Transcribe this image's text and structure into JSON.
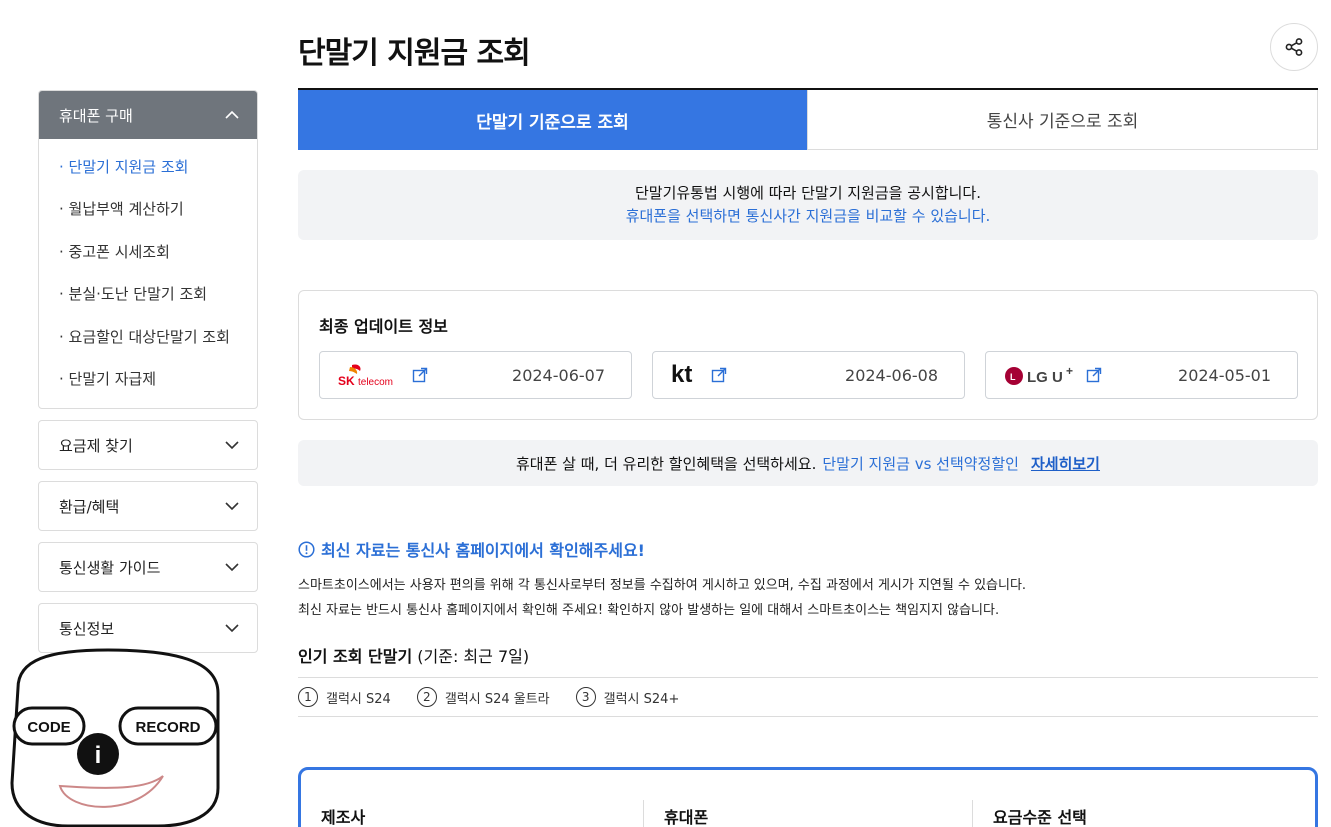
{
  "page": {
    "title": "단말기 지원금 조회"
  },
  "sidebar": {
    "open_section": {
      "label": "휴대폰 구매",
      "items": [
        {
          "label": "· 단말기 지원금 조회",
          "active": true
        },
        {
          "label": "· 월납부액 계산하기",
          "active": false
        },
        {
          "label": "· 중고폰 시세조회",
          "active": false
        },
        {
          "label": "· 분실·도난 단말기 조회",
          "active": false
        },
        {
          "label": "· 요금할인 대상단말기 조회",
          "active": false
        },
        {
          "label": "· 단말기 자급제",
          "active": false
        }
      ]
    },
    "closed_sections": [
      "요금제 찾기",
      "환급/혜택",
      "통신생활 가이드",
      "통신정보"
    ]
  },
  "tabs": [
    {
      "label": "단말기 기준으로 조회",
      "active": true
    },
    {
      "label": "통신사 기준으로 조회",
      "active": false
    }
  ],
  "notice": {
    "line1": "단말기유통법 시행에 따라 단말기 지원금을 공시합니다.",
    "line2": "휴대폰을 선택하면 통신사간 지원금을 비교할 수 있습니다."
  },
  "update": {
    "title": "최종 업데이트 정보",
    "carriers": [
      {
        "name": "SK telecom",
        "date": "2024-06-07"
      },
      {
        "name": "kt",
        "date": "2024-06-08"
      },
      {
        "name": "LG U+",
        "date": "2024-05-01"
      }
    ]
  },
  "promo": {
    "text": "휴대폰 살 때, 더 유리한 할인혜택을 선택하세요.",
    "highlight": "단말기 지원금 vs 선택약정할인",
    "link": "자세히보기"
  },
  "alert": {
    "title": "최신 자료는 통신사 홈페이지에서 확인해주세요!",
    "line1": "스마트초이스에서는 사용자 편의를 위해 각 통신사로부터 정보를 수집하여 게시하고 있으며, 수집 과정에서 게시가 지연될 수 있습니다.",
    "line2": "최신 자료는 반드시 통신사 홈페이지에서 확인해 주세요! 확인하지 않아 발생하는 일에 대해서 스마트초이스는 책임지지 않습니다."
  },
  "popular": {
    "title_bold": "인기 조회 단말기",
    "title_note": " (기준: 최근 7일)",
    "items": [
      {
        "rank": "1",
        "name": "갤럭시 S24"
      },
      {
        "rank": "2",
        "name": "갤럭시 S24 울트라"
      },
      {
        "rank": "3",
        "name": "갤럭시 S24+"
      }
    ]
  },
  "filter": {
    "maker": "제조사",
    "phone": "휴대폰",
    "plan": "요금수준 선택"
  },
  "mascot": {
    "left": "CODE",
    "right": "RECORD",
    "center": "i"
  },
  "colors": {
    "accent": "#3576e2",
    "link": "#2b6fd6",
    "sidebar_head": "#6f757c",
    "panel_bg": "#f2f3f5"
  }
}
